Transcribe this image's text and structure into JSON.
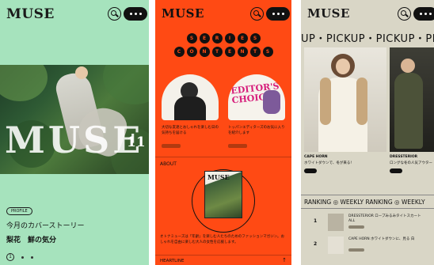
{
  "phone1": {
    "logo": "MUSE",
    "hero_text": "MUSE",
    "issue_number": "11",
    "badge": "PROFILE",
    "cover_title": "今月のカバーストーリー",
    "cover_subtitle": "梨花　鮮の気分",
    "page_number": "1"
  },
  "phone2": {
    "logo": "MUSE",
    "series_row1": [
      "S",
      "E",
      "R",
      "I",
      "E",
      "S"
    ],
    "series_row2": [
      "C",
      "O",
      "N",
      "T",
      "E",
      "N",
      "T",
      "S"
    ],
    "card1_text": "大切な友達とおしゃれを楽しむ日の気持ちを届ける",
    "card2_choice": "EDITOR'S CHOICE",
    "card2_text": "トッパンエディターズのお気に入りを紹介します",
    "about_label": "ABOUT",
    "mag_logo": "MUSE",
    "about_text": "オトナミューズは「年齢」を楽しむ人たちのためのファッションマガジン。おしゃれを自由に楽しむ大人の女性を応援します。",
    "heartline_label": "HEARTLINE",
    "scroll_top": "↑"
  },
  "phone3": {
    "logo": "MUSE",
    "pickup_marquee": "UP・PICKUP・PICKUP・PICKUP",
    "products": [
      {
        "brand": "CAPE HORN",
        "desc": "ホワイトダウンで、冬が来る!"
      },
      {
        "brand": "DRESSTERIOR",
        "desc": "ロングな冬の人気アウター"
      }
    ],
    "ranking_bar": "RANKING ◎ WEEKLY RANKING ◎ WEEKLY",
    "ranking": [
      {
        "rank": "1",
        "text": "DRESSTERIOR ロープみるみタイトスカート　ALL"
      },
      {
        "rank": "2",
        "text": "CAPE HORN ホワイトダウンに、見る 白"
      }
    ]
  }
}
